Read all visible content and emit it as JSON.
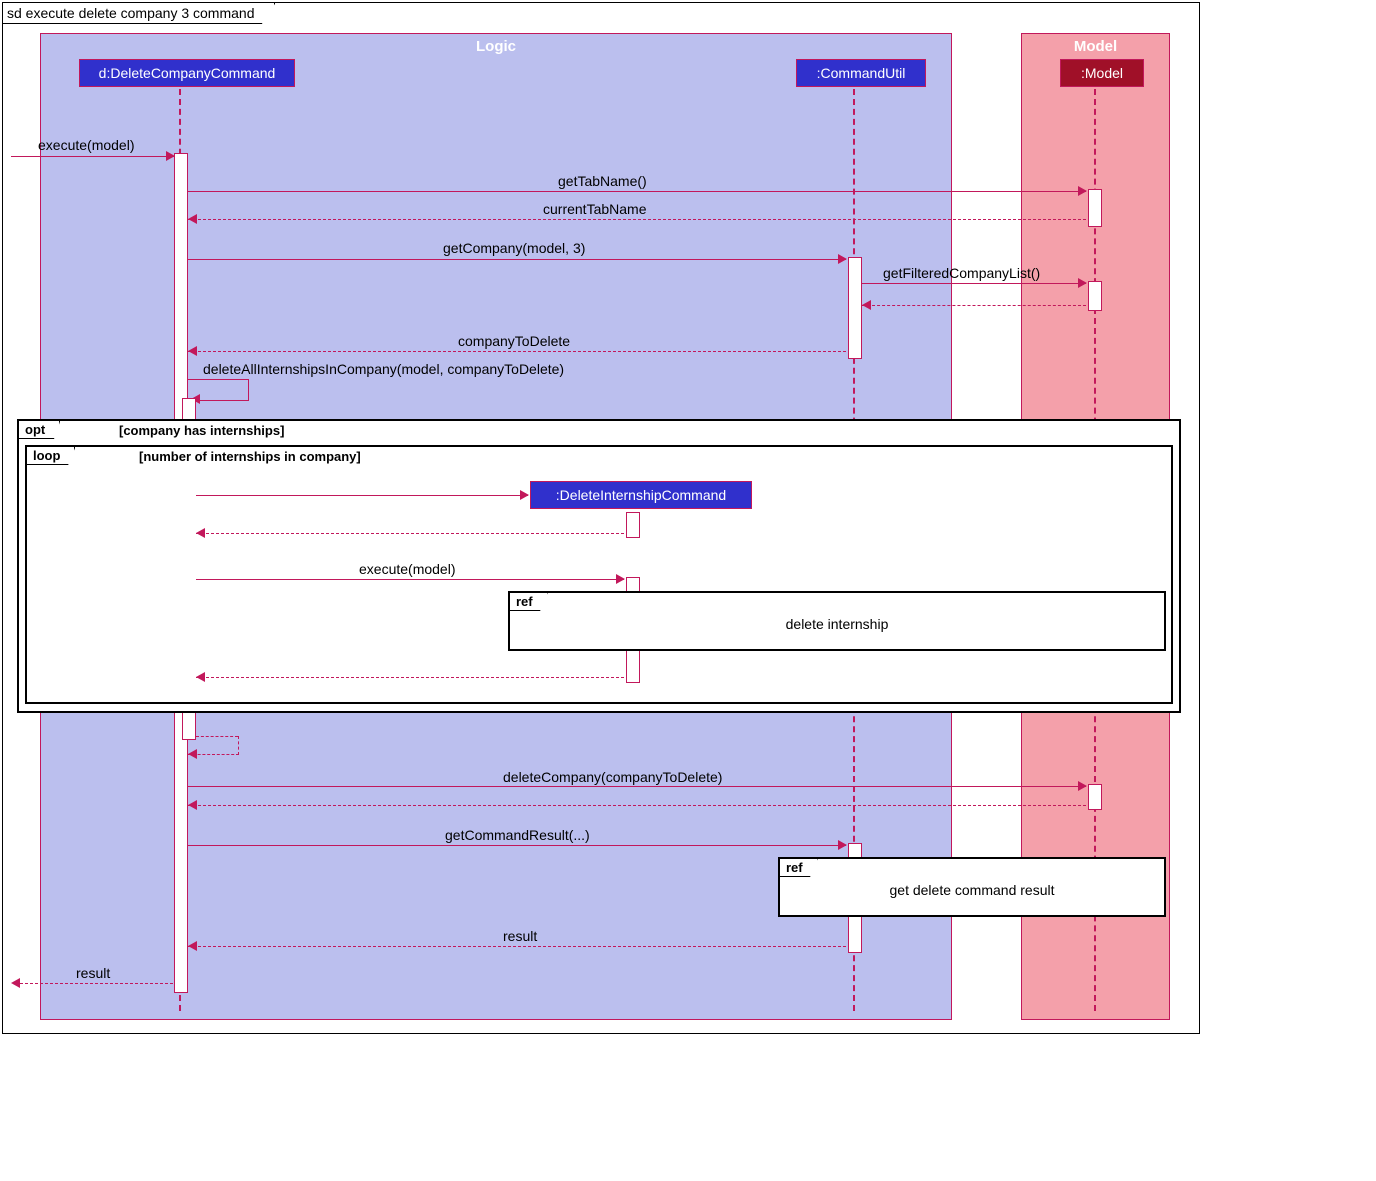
{
  "title": "sd execute delete company 3 command",
  "groups": {
    "logic": "Logic",
    "model": "Model"
  },
  "participants": {
    "deleteCompany": "d:DeleteCompanyCommand",
    "commandUtil": ":CommandUtil",
    "deleteInternship": ":DeleteInternshipCommand",
    "model": ":Model"
  },
  "messages": {
    "m0": "execute(model)",
    "m1": "getTabName()",
    "r1": "currentTabName",
    "m2": "getCompany(model, 3)",
    "m3": "getFilteredCompanyList()",
    "r3": "companyToDelete",
    "m4": "deleteAllInternshipsInCompany(model, companyToDelete)",
    "m5": "execute(model)",
    "m6": "deleteCompany(companyToDelete)",
    "m7": "getCommandResult(...)",
    "r7": "result",
    "r8": "result"
  },
  "fragments": {
    "opt": "opt",
    "optGuard": "[company has internships]",
    "loop": "loop",
    "loopGuard": "[number of internships in company]",
    "ref": "ref",
    "ref1Label": "delete internship",
    "ref2Label": "get delete command result"
  }
}
